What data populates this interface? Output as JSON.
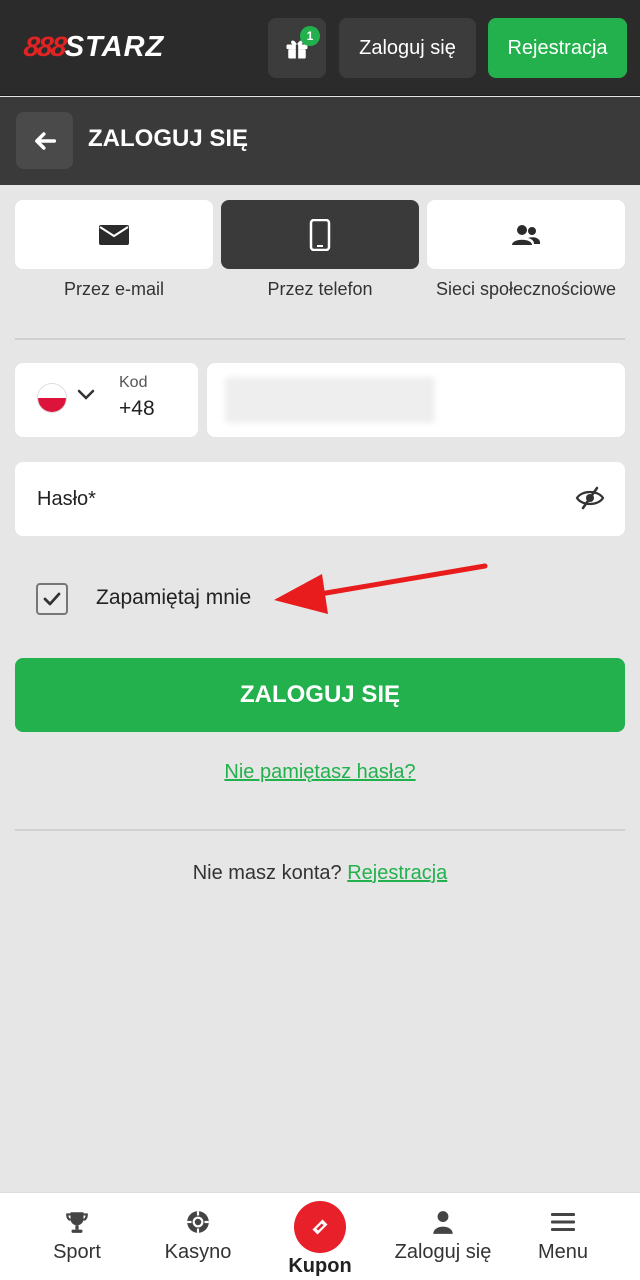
{
  "header": {
    "logo_mark": "888",
    "logo_text": "STARZ",
    "gift_badge": "1",
    "login_label": "Zaloguj się",
    "register_label": "Rejestracja"
  },
  "titlebar": {
    "title": "ZALOGUJ SIĘ"
  },
  "methods": [
    {
      "label": "Przez e-mail",
      "icon": "envelope-icon",
      "active": false
    },
    {
      "label": "Przez telefon",
      "icon": "smartphone-icon",
      "active": true
    },
    {
      "label": "Sieci społecznościowe",
      "icon": "users-icon",
      "active": false
    }
  ],
  "phone": {
    "code_label": "Kod",
    "code_value": "+48",
    "flag": "poland-flag-icon"
  },
  "password": {
    "placeholder": "Hasło*"
  },
  "remember": {
    "label": "Zapamiętaj mnie",
    "checked": true
  },
  "submit_label": "ZALOGUJ SIĘ",
  "forgot_label": "Nie pamiętasz hasła?",
  "signup": {
    "question": "Nie masz konta?",
    "link": "Rejestracja"
  },
  "bottom_nav": [
    {
      "label": "Sport",
      "icon": "trophy-icon"
    },
    {
      "label": "Kasyno",
      "icon": "casino-chip-icon"
    },
    {
      "label": "Kupon",
      "icon": "ticket-icon"
    },
    {
      "label": "Zaloguj się",
      "icon": "user-icon"
    },
    {
      "label": "Menu",
      "icon": "menu-icon"
    }
  ],
  "colors": {
    "accent_green": "#22b14c",
    "header_dark": "#2b2b2b",
    "brand_red": "#e02424"
  }
}
